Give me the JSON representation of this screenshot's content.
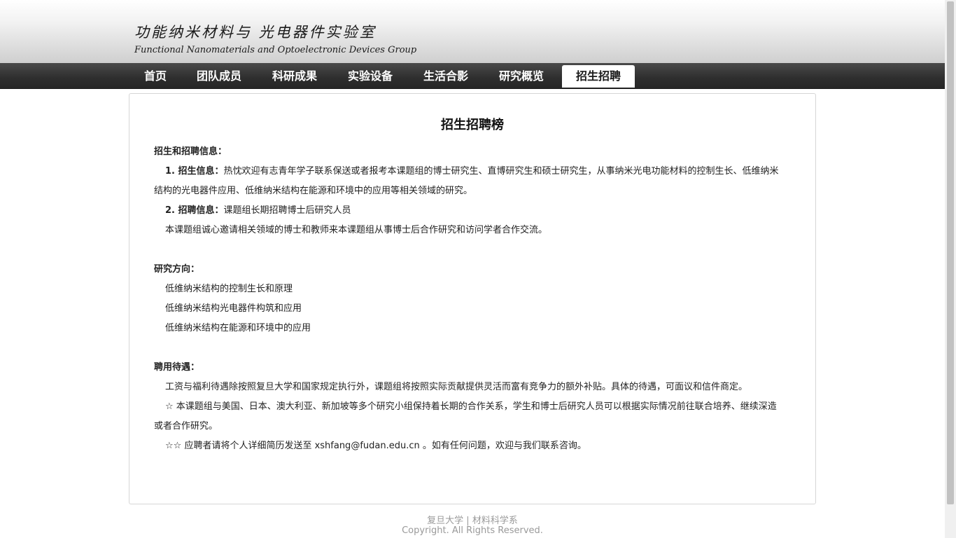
{
  "header": {
    "title_cn": "功能纳米材料与 光电器件实验室",
    "title_en": "Functional Nanomaterials and Optoelectronic Devices Group"
  },
  "nav": {
    "items": [
      {
        "label": "首页"
      },
      {
        "label": "团队成员"
      },
      {
        "label": "科研成果"
      },
      {
        "label": "实验设备"
      },
      {
        "label": "生活合影"
      },
      {
        "label": "研究概览"
      },
      {
        "label": "招生招聘"
      }
    ],
    "active_index": 6
  },
  "main": {
    "title": "招生招聘榜",
    "recruit": {
      "heading": "招生和招聘信息：",
      "item1_label": "1. 招生信息：",
      "item1_text": "热忱欢迎有志青年学子联系保送或者报考本课题组的博士研究生、直博研究生和硕士研究生，从事纳米光电功能材料的控制生长、低维纳米结构的光电器件应用、低维纳米结构在能源和环境中的应用等相关领域的研究。",
      "item2_label": "2. 招聘信息：",
      "item2_text": "课题组长期招聘博士后研究人员",
      "item2_note": "本课题组诚心邀请相关领域的博士和教师来本课题组从事博士后合作研究和访问学者合作交流。"
    },
    "research": {
      "heading": "研究方向：",
      "items": [
        "低维纳米结构的控制生长和原理",
        "低维纳米结构光电器件构筑和应用",
        "低维纳米结构在能源和环境中的应用"
      ]
    },
    "benefits": {
      "heading": "聘用待遇：",
      "p1": "工资与福利待遇除按照复旦大学和国家规定执行外，课题组将按照实际贡献提供灵活而富有竞争力的额外补贴。具体的待遇，可面议和信件商定。",
      "p2": "☆ 本课题组与美国、日本、澳大利亚、新加坡等多个研究小组保持着长期的合作关系，学生和博士后研究人员可以根据实际情况前往联合培养、继续深造或者合作研究。",
      "p3": "☆☆ 应聘者请将个人详细简历发送至 xshfang@fudan.edu.cn 。如有任何问题，欢迎与我们联系咨询。"
    }
  },
  "footer": {
    "line1": "复旦大学 | 材料科学系",
    "line2": "Copyright. All Rights Reserved."
  }
}
